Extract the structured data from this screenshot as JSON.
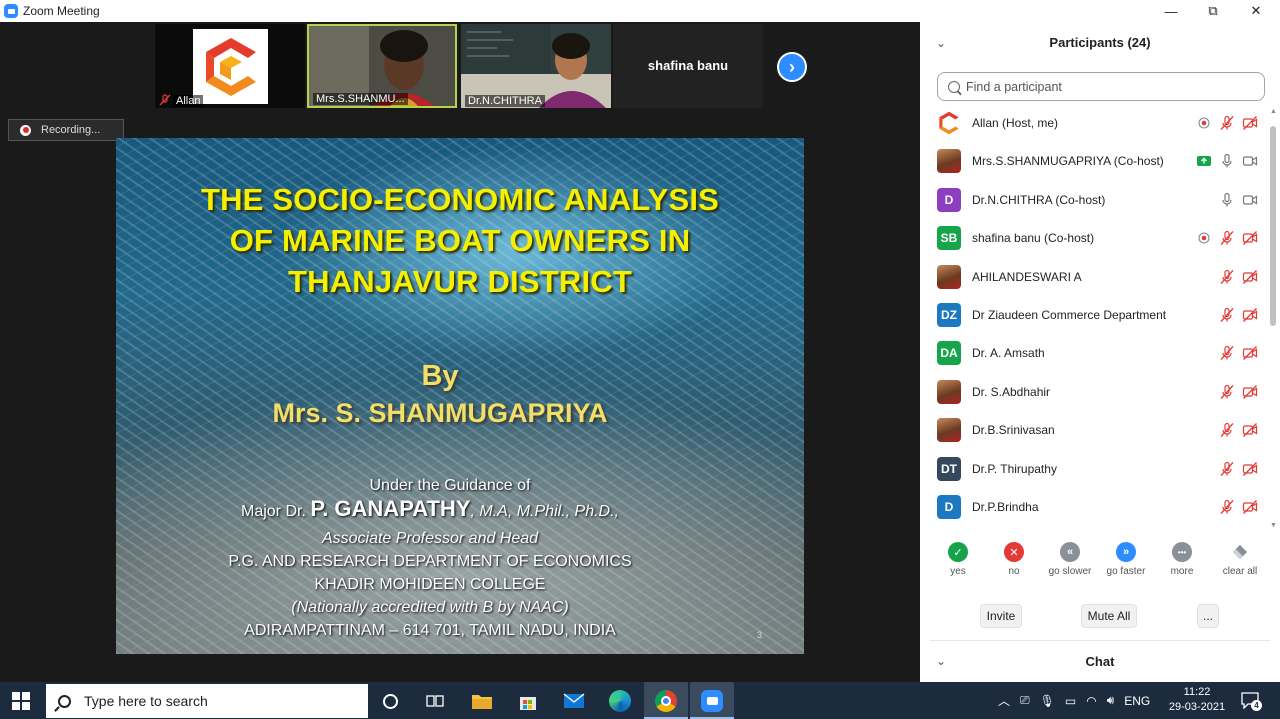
{
  "window": {
    "title": "Zoom Meeting",
    "minimize_label": "—",
    "restore_label": "⧉",
    "close_label": "✕"
  },
  "video_strip": {
    "tiles": [
      {
        "name": "Allan",
        "kind": "logo",
        "muted": true
      },
      {
        "name": "Mrs.S.SHANMU...",
        "kind": "video",
        "muted": false
      },
      {
        "name": "Dr.N.CHITHRA",
        "kind": "video",
        "muted": true
      },
      {
        "name": "shafina banu",
        "kind": "name-only",
        "muted": false
      }
    ],
    "next_label": "›"
  },
  "recording": {
    "label": "Recording..."
  },
  "slide": {
    "title_lines": [
      "THE SOCIO-ECONOMIC ANALYSIS",
      "OF MARINE BOAT OWNERS IN",
      "THANJAVUR DISTRICT"
    ],
    "by": "By",
    "author": "Mrs. S. SHANMUGAPRIYA",
    "guidance_intro": "Under the Guidance of",
    "guide_prefix": "Major Dr.",
    "guide_name": "P. GANAPATHY",
    "guide_degrees": ", M.A, M.Phil., Ph.D.,",
    "guide_role": "Associate Professor and Head",
    "department": "P.G. AND RESEARCH DEPARTMENT OF ECONOMICS",
    "college": "KHADIR MOHIDEEN COLLEGE",
    "accreditation": "(Nationally accredited with B by NAAC)",
    "address": "ADIRAMPATTINAM – 614 701, TAMIL NADU, INDIA",
    "page_number": "3"
  },
  "participants": {
    "title": "Participants (24)",
    "search_placeholder": "Find a participant",
    "list": [
      {
        "initials": "",
        "avatar": "logo",
        "name": "Allan (Host, me)",
        "status": "recording",
        "mic": "muted",
        "video": "off"
      },
      {
        "initials": "",
        "avatar": "photo",
        "name": "Mrs.S.SHANMUGAPRIYA (Co-host)",
        "status": "sharing",
        "mic": "on",
        "video": "on"
      },
      {
        "initials": "D",
        "avatar": "#8e3fbf",
        "name": "Dr.N.CHITHRA (Co-host)",
        "status": "",
        "mic": "on",
        "video": "on"
      },
      {
        "initials": "SB",
        "avatar": "#17a44a",
        "name": "shafina banu (Co-host)",
        "status": "recording",
        "mic": "muted",
        "video": "off"
      },
      {
        "initials": "",
        "avatar": "photo",
        "name": "AHILANDESWARI A",
        "status": "",
        "mic": "muted",
        "video": "off"
      },
      {
        "initials": "DZ",
        "avatar": "#1c79c0",
        "name": "Dr Ziaudeen Commerce Department",
        "status": "",
        "mic": "muted",
        "video": "off"
      },
      {
        "initials": "DA",
        "avatar": "#17a44a",
        "name": "Dr. A. Amsath",
        "status": "",
        "mic": "muted",
        "video": "off"
      },
      {
        "initials": "",
        "avatar": "photo",
        "name": "Dr. S.Abdhahir",
        "status": "",
        "mic": "muted",
        "video": "off"
      },
      {
        "initials": "",
        "avatar": "photo",
        "name": "Dr.B.Srinivasan",
        "status": "",
        "mic": "muted",
        "video": "off"
      },
      {
        "initials": "DT",
        "avatar": "#34495e",
        "name": "Dr.P. Thirupathy",
        "status": "",
        "mic": "muted",
        "video": "off"
      },
      {
        "initials": "D",
        "avatar": "#1c79c0",
        "name": "Dr.P.Brindha",
        "status": "",
        "mic": "muted",
        "video": "off"
      }
    ],
    "reactions": [
      {
        "label": "yes",
        "symbol": "✓",
        "color": "#16a34a"
      },
      {
        "label": "no",
        "symbol": "✕",
        "color": "#e53935"
      },
      {
        "label": "go slower",
        "symbol": "«",
        "color": "#8a8f98"
      },
      {
        "label": "go faster",
        "symbol": "»",
        "color": "#2d8cff"
      },
      {
        "label": "more",
        "symbol": "•••",
        "color": "#8a8f98"
      },
      {
        "label": "clear all",
        "symbol": "",
        "color": "#8a8f98"
      }
    ],
    "invite_label": "Invite",
    "mute_all_label": "Mute All",
    "more_label": "...",
    "chat_label": "Chat"
  },
  "taskbar": {
    "search_placeholder": "Type here to search",
    "language": "ENG",
    "time": "11:22",
    "date": "29-03-2021",
    "notification_count": "4"
  },
  "colors": {
    "accent": "#2d8cff",
    "slide_title": "#f4f000",
    "muted_red": "#e53935"
  }
}
